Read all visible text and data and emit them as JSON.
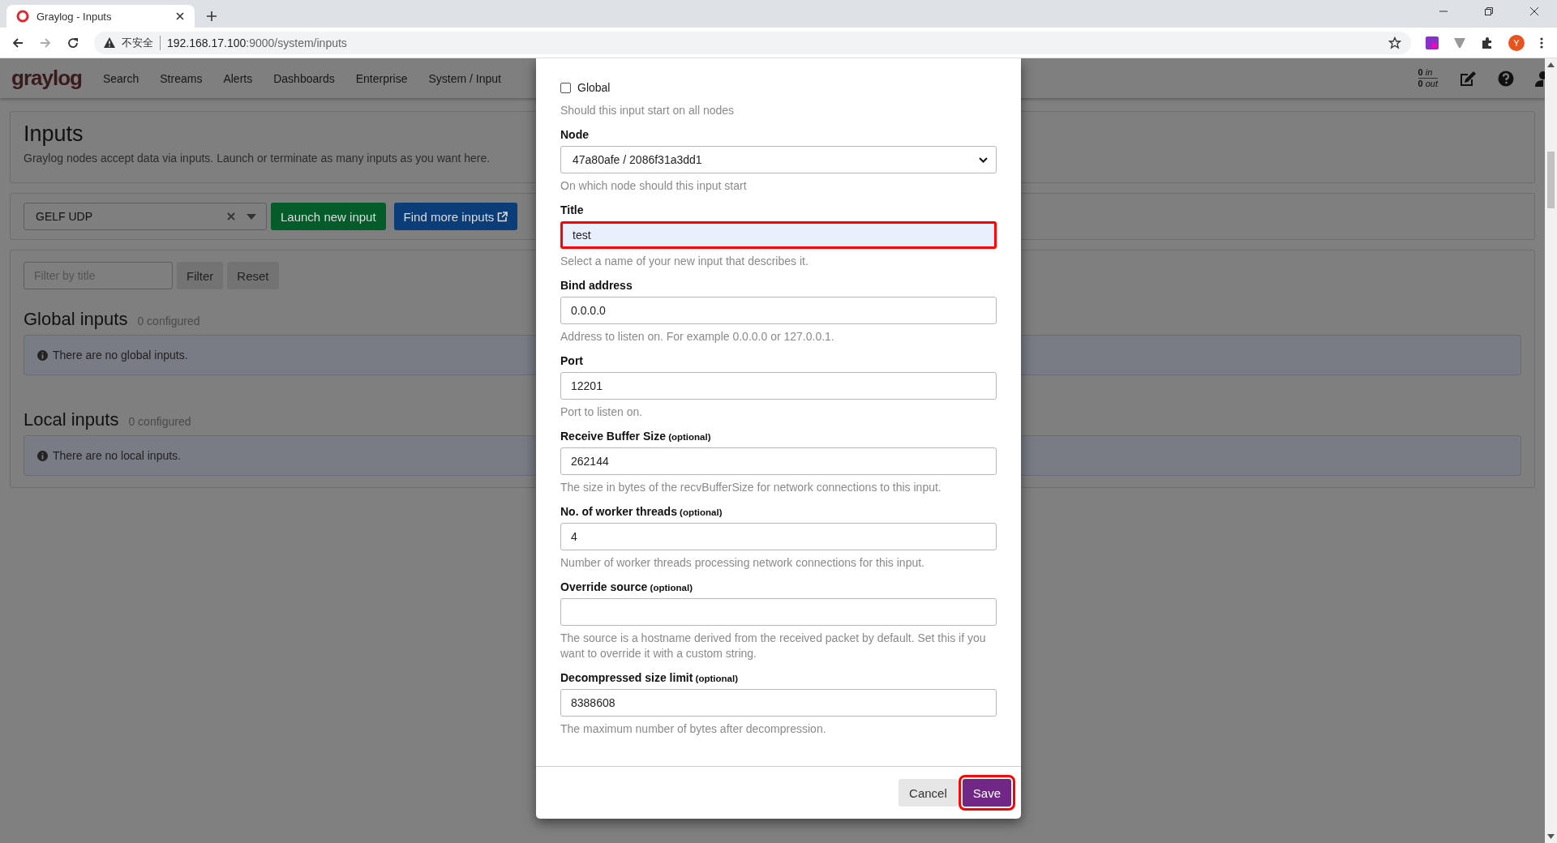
{
  "browser": {
    "tab_title": "Graylog - Inputs",
    "security_label": "不安全",
    "url_host": "192.168.17.100",
    "url_rest": ":9000/system/inputs",
    "avatar_letter": "Y"
  },
  "nav": {
    "logo": "graylog",
    "items": [
      "Search",
      "Streams",
      "Alerts",
      "Dashboards",
      "Enterprise",
      "System / Input"
    ],
    "throughput": {
      "in_value": "0",
      "in_label": "in",
      "out_value": "0",
      "out_label": "out"
    }
  },
  "page": {
    "title": "Inputs",
    "description": "Graylog nodes accept data via inputs. Launch or terminate as many inputs as you want here.",
    "input_type": {
      "value": "GELF UDP"
    },
    "launch_button": "Launch new input",
    "find_more_button": "Find more inputs",
    "filter": {
      "placeholder": "Filter by title"
    },
    "filter_button": "Filter",
    "reset_button": "Reset",
    "sections": [
      {
        "title": "Global inputs",
        "count": "0 configured",
        "empty_message": "There are no global inputs."
      },
      {
        "title": "Local inputs",
        "count": "0 configured",
        "empty_message": "There are no local inputs."
      }
    ]
  },
  "modal": {
    "global": {
      "label": "Global",
      "checked": false,
      "help": "Should this input start on all nodes"
    },
    "fields": [
      {
        "kind": "select",
        "label": "Node",
        "value": "47a80afe / 2086f31a3dd1",
        "help": "On which node should this input start",
        "highlighted": false
      },
      {
        "kind": "text",
        "label": "Title",
        "value": "test",
        "help": "Select a name of your new input that describes it.",
        "highlighted": true
      },
      {
        "kind": "text",
        "label": "Bind address",
        "value": "0.0.0.0",
        "help": "Address to listen on. For example 0.0.0.0 or 127.0.0.1.",
        "highlighted": false
      },
      {
        "kind": "text",
        "label": "Port",
        "value": "12201",
        "help": "Port to listen on.",
        "highlighted": false
      },
      {
        "kind": "text",
        "label": "Receive Buffer Size",
        "optional": "(optional)",
        "value": "262144",
        "help": "The size in bytes of the recvBufferSize for network connections to this input.",
        "highlighted": false
      },
      {
        "kind": "text",
        "label": "No. of worker threads",
        "optional": "(optional)",
        "value": "4",
        "help": "Number of worker threads processing network connections for this input.",
        "highlighted": false
      },
      {
        "kind": "text",
        "label": "Override source",
        "optional": "(optional)",
        "help": "The source is a hostname derived from the received packet by default. Set this if you want to override it with a custom string.",
        "highlighted": false
      },
      {
        "kind": "text",
        "label": "Decompressed size limit",
        "optional": "(optional)",
        "value": "8388608",
        "help": "The maximum number of bytes after decompression.",
        "highlighted": false
      }
    ],
    "buttons": [
      {
        "kind": "default",
        "label": "Cancel",
        "highlighted": false
      },
      {
        "kind": "primary",
        "label": "Save",
        "highlighted": true
      }
    ]
  }
}
